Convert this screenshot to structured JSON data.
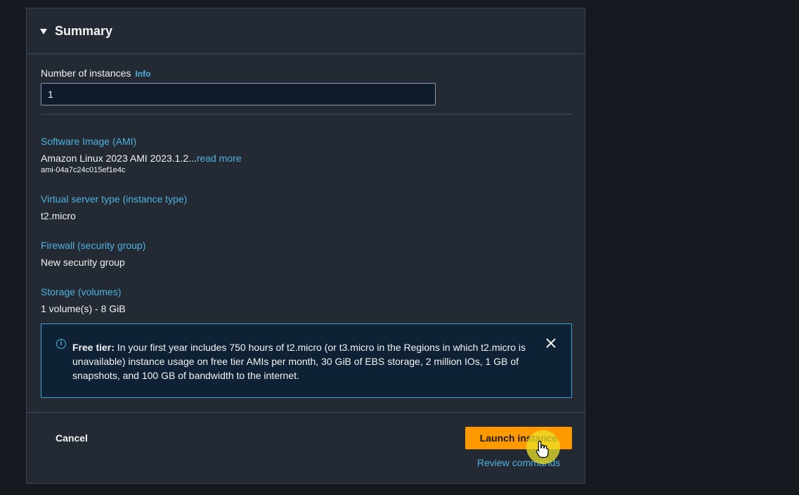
{
  "summary": {
    "title": "Summary",
    "instances_label": "Number of instances",
    "info_link": "Info",
    "instances_value": "1",
    "ami": {
      "title": "Software Image (AMI)",
      "value": "Amazon Linux 2023 AMI 2023.1.2...",
      "read_more": "read more",
      "id": "ami-04a7c24c015ef1e4c"
    },
    "instance_type": {
      "title": "Virtual server type (instance type)",
      "value": "t2.micro"
    },
    "firewall": {
      "title": "Firewall (security group)",
      "value": "New security group"
    },
    "storage": {
      "title": "Storage (volumes)",
      "value": "1 volume(s) - 8 GiB"
    },
    "free_tier": {
      "label": "Free tier:",
      "text": " In your first year includes 750 hours of t2.micro (or t3.micro in the Regions in which t2.micro is unavailable) instance usage on free tier AMIs per month, 30 GiB of EBS storage, 2 million IOs, 1 GB of snapshots, and 100 GB of bandwidth to the internet."
    }
  },
  "footer": {
    "cancel": "Cancel",
    "launch": "Launch instance",
    "review": "Review commands"
  },
  "icons": {
    "caret": "caret-down-icon",
    "info": "info-circle-icon",
    "close": "close-icon",
    "cursor": "hand-pointer-icon"
  },
  "colors": {
    "background": "#16191f",
    "panel": "#232a33",
    "link": "#4fb3e0",
    "primary_button": "#ff9900",
    "alert_border": "#3aa2d6"
  }
}
